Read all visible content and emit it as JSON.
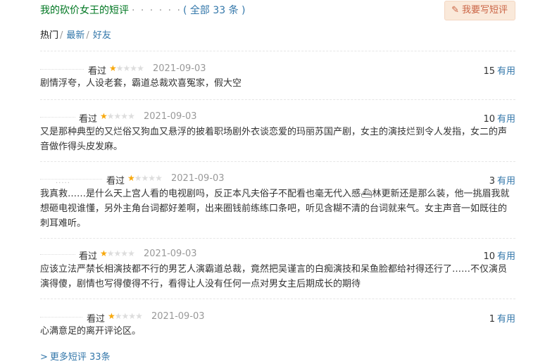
{
  "header": {
    "title": "我的砍价女王的短评",
    "dots": "· · · · · ·",
    "count": "( 全部 33 条 )",
    "write_button": "我要写短评"
  },
  "filters": [
    {
      "label": "热门",
      "sep": "/"
    },
    {
      "label": "最新",
      "sep": "/"
    },
    {
      "label": "好友",
      "sep": ""
    }
  ],
  "comments": [
    {
      "watched": "看过",
      "rating": 1,
      "date": "2021-09-03",
      "votes": "15",
      "useful": "有用",
      "text": "剧情浮夸，人设老套，霸道总裁欢喜冤家，假大空"
    },
    {
      "watched": "看过",
      "rating": 1,
      "date": "2021-09-03",
      "votes": "10",
      "useful": "有用",
      "text": "又是那种典型的又烂俗又狗血又悬浮的披着职场剧外衣谈恋爱的玛丽苏国产剧，女主的演技烂到令人发指，女二的声音做作得头皮发麻。"
    },
    {
      "watched": "看过",
      "rating": 1,
      "date": "2021-09-03",
      "votes": "3",
      "useful": "有用",
      "text": "我真救……是什么天上宫人看的电视剧吗，反正本凡夫俗子不配看也毫无代入感⛴林更新还是那么装，他一挑眉我就想砸电视谁懂，另外主角台词都好差啊，出来圈钱前练练口条吧，听见含糊不清的台词就来气。女主声音一如既往的刺耳难听。"
    },
    {
      "watched": "看过",
      "rating": 1,
      "date": "2021-09-03",
      "votes": "10",
      "useful": "有用",
      "text": "应该立法严禁长相演技都不行的男艺人演霸道总裁，竟然把吴谨言的白痴演技和呆鱼脸都给衬得还行了……不仅演员演得傻，剧情也写得傻得不行，看得让人没有任何一点对男女主后期成长的期待"
    },
    {
      "watched": "看过",
      "rating": 1,
      "date": "2021-09-03",
      "votes": "1",
      "useful": "有用",
      "text": "心满意足的离开评论区。"
    }
  ],
  "more_link": "更多短评 33条",
  "more_arrow": ">",
  "colors": {
    "title_green": "#007722",
    "link_blue": "#3377aa",
    "star_on": "#f7a80c",
    "star_off": "#dddddd",
    "button_bg": "#fae9da",
    "button_text": "#ca6445"
  }
}
